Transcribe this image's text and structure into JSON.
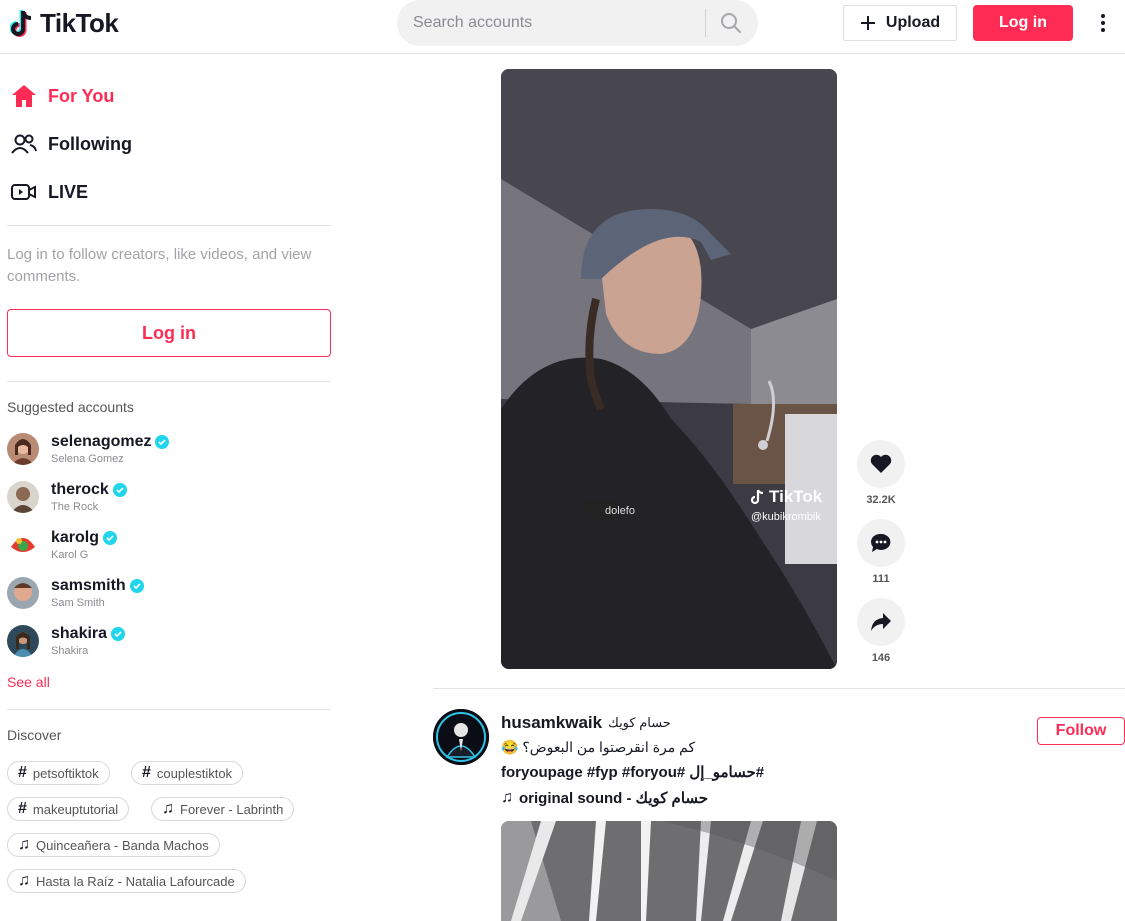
{
  "header": {
    "logo_text": "TikTok",
    "search_placeholder": "Search accounts",
    "upload_label": "Upload",
    "login_label": "Log in"
  },
  "sidebar": {
    "nav": [
      {
        "label": "For You",
        "icon": "home-icon",
        "active": true
      },
      {
        "label": "Following",
        "icon": "users-icon"
      },
      {
        "label": "LIVE",
        "icon": "live-camera-icon"
      }
    ],
    "login_prompt": "Log in to follow creators, like videos, and view comments.",
    "login_label": "Log in",
    "suggested_title": "Suggested accounts",
    "accounts": [
      {
        "username": "selenagomez",
        "name": "Selena Gomez"
      },
      {
        "username": "therock",
        "name": "The Rock"
      },
      {
        "username": "karolg",
        "name": "Karol G"
      },
      {
        "username": "samsmith",
        "name": "Sam Smith"
      },
      {
        "username": "shakira",
        "name": "Shakira"
      }
    ],
    "see_all": "See all",
    "discover_title": "Discover",
    "discover": [
      {
        "label": "petsoftiktok",
        "type": "hashtag"
      },
      {
        "label": "couplestiktok",
        "type": "hashtag"
      },
      {
        "label": "makeuptutorial",
        "type": "hashtag"
      },
      {
        "label": "Forever - Labrinth",
        "type": "music"
      },
      {
        "label": "Quinceañera - Banda Machos",
        "type": "music"
      },
      {
        "label": "Hasta la Raíz - Natalia Lafourcade",
        "type": "music"
      }
    ]
  },
  "feed": {
    "video1": {
      "watermark_logo": "TikTok",
      "watermark_user": "@kubikrombik",
      "likes": "32.2K",
      "comments": "111",
      "shares": "146"
    },
    "post2": {
      "username": "husamkwaik",
      "nickname": "حسام كويك",
      "caption": "كم مرة انقرصتوا من البعوض؟ 😂",
      "tags": "#حسامو_إل #foryoupage #fyp #foryou",
      "sound": "original sound - حسام كويك",
      "follow_label": "Follow"
    }
  },
  "colors": {
    "accent": "#fe2c55",
    "verified": "#20d5ec"
  }
}
